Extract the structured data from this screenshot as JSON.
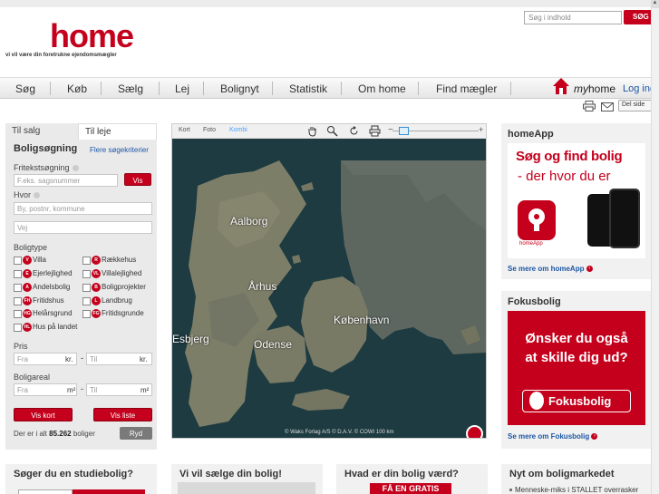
{
  "header": {
    "search_placeholder": "Søg i indhold",
    "search_button": "SØG",
    "logo": "home",
    "tagline": "vi vil være din foretrukne ejendomsmægler"
  },
  "nav": {
    "items": [
      "Søg",
      "Køb",
      "Sælg",
      "Lej",
      "Bolignyt",
      "Statistik",
      "Om home",
      "Find mægler"
    ],
    "myhome_prefix": "my",
    "myhome_suffix": "home",
    "login": "Log ind"
  },
  "utility": {
    "share": "Del side"
  },
  "search_panel": {
    "tab_sale": "Til salg",
    "tab_rent": "Til leje",
    "title": "Boligsøgning",
    "more_criteria": "Flere søgekriterier",
    "freetext_label": "Fritekstsøgning",
    "freetext_placeholder": "F.eks. sagsnummer",
    "view_button": "Vis",
    "where_label": "Hvor",
    "where_placeholder": "By, postnr, kommune",
    "road_placeholder": "Vej",
    "type_label": "Boligtype",
    "types_left": [
      {
        "code": "V",
        "label": "Villa"
      },
      {
        "code": "E",
        "label": "Ejerlejlighed"
      },
      {
        "code": "A",
        "label": "Andelsbolig"
      },
      {
        "code": "FH",
        "label": "Fritidshus"
      },
      {
        "code": "HG",
        "label": "Helårsgrund"
      },
      {
        "code": "HL",
        "label": "Hus på landet"
      }
    ],
    "types_right": [
      {
        "code": "R",
        "label": "Rækkehus"
      },
      {
        "code": "VL",
        "label": "Villalejlighed"
      },
      {
        "code": "B",
        "label": "Boligprojekter"
      },
      {
        "code": "L",
        "label": "Landbrug"
      },
      {
        "code": "FG",
        "label": "Fritidsgrunde"
      }
    ],
    "price_label": "Pris",
    "price_from": "Fra",
    "price_to": "Til",
    "price_unit": "kr.",
    "area_label": "Boligareal",
    "area_from": "Fra",
    "area_to": "Til",
    "area_unit": "m²",
    "show_map": "Vis kort",
    "show_list": "Vis liste",
    "total_prefix": "Der er i alt",
    "total_count": "85.262",
    "total_suffix": "boliger",
    "reset": "Ryd"
  },
  "map": {
    "tabs": [
      "Kort",
      "Foto",
      "Kombi"
    ],
    "active_tab": "Kombi",
    "cities": [
      "Aalborg",
      "Århus",
      "Esbjerg",
      "Odense",
      "København"
    ],
    "credit": "© Waks Forlag A/S © D.A.V. © COWI",
    "scale": "100 km"
  },
  "right": {
    "app_title": "homeApp",
    "app_ad_line1": "Søg og find bolig",
    "app_ad_line2": "- der hvor du er",
    "app_ad_icon_label": "homeApp",
    "app_link": "Se mere om homeApp",
    "focus_title": "Fokusbolig",
    "focus_ad_line1": "Ønsker du også",
    "focus_ad_line2": "at skille dig ud?",
    "focus_ad_button": "Fokusbolig",
    "focus_link": "Se mere om Fokusbolig"
  },
  "bottom": {
    "box1_title": "Søger du en studiebolig?",
    "box2_title": "Vi vil sælge din bolig!",
    "box3_title": "Hvad er din bolig værd?",
    "box3_banner": "FÅ EN GRATIS",
    "box4_title": "Nyt om boligmarkedet",
    "box4_item": "Menneske-miks i STALLET overrasker"
  },
  "colors": {
    "brand": "#c4001c",
    "link": "#1c57a5"
  }
}
